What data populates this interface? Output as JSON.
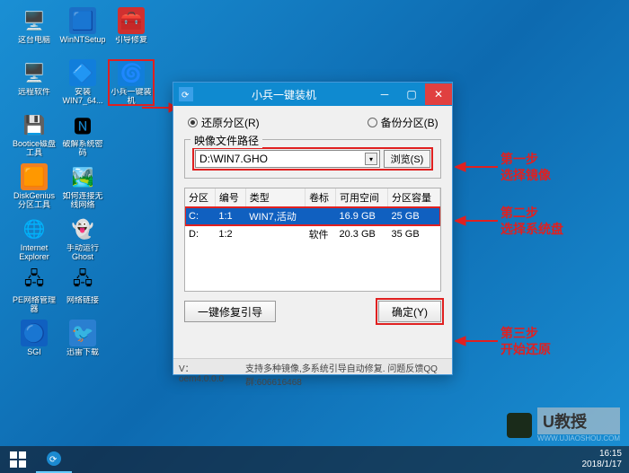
{
  "desktop": {
    "rows": [
      [
        {
          "label": "这台电脑",
          "emoji": "🖥️",
          "bg": ""
        },
        {
          "label": "WinNTSetup",
          "emoji": "🟦",
          "bg": "#1b6fc6"
        },
        {
          "label": "引导修复",
          "emoji": "🧰",
          "bg": "#d03030"
        }
      ],
      [
        {
          "label": "远程软件",
          "emoji": "🖥️",
          "bg": ""
        },
        {
          "label": "安装WIN7_64...",
          "emoji": "🔷",
          "bg": "#117edb"
        },
        {
          "label": "小兵一键装机",
          "emoji": "🌀",
          "bg": "#117edb",
          "highlight": true
        }
      ],
      [
        {
          "label": "Bootice磁盘工具",
          "emoji": "💾",
          "bg": ""
        },
        {
          "label": "破解系统密码",
          "emoji": "🅽",
          "bg": ""
        }
      ],
      [
        {
          "label": "DiskGenius分区工具",
          "emoji": "🟧",
          "bg": "#f08020"
        },
        {
          "label": "如何连接无线网络",
          "emoji": "🏞️",
          "bg": ""
        }
      ],
      [
        {
          "label": "Internet Explorer",
          "emoji": "🌐",
          "bg": ""
        },
        {
          "label": "手动运行Ghost",
          "emoji": "👻",
          "bg": ""
        }
      ],
      [
        {
          "label": "PE网络管理器",
          "emoji": "🖧",
          "bg": ""
        },
        {
          "label": "网络链接",
          "emoji": "🖧",
          "bg": ""
        }
      ],
      [
        {
          "label": "SGI",
          "emoji": "🔵",
          "bg": "#1060c0"
        },
        {
          "label": "迅雷下载",
          "emoji": "🐦",
          "bg": "#2a7fd0"
        }
      ]
    ]
  },
  "window": {
    "title": "小兵一键装机",
    "radio_restore": "还原分区(R)",
    "radio_backup": "备份分区(B)",
    "fieldset_label": "映像文件路径",
    "path_value": "D:\\WIN7.GHO",
    "browse_label": "浏览(S)",
    "table": {
      "headers": [
        "分区",
        "编号",
        "类型",
        "卷标",
        "可用空间",
        "分区容量"
      ],
      "rows": [
        {
          "cells": [
            "C:",
            "1:1",
            "WIN7,活动",
            "",
            "16.9 GB",
            "25 GB"
          ],
          "selected": true
        },
        {
          "cells": [
            "D:",
            "1:2",
            "",
            "软件",
            "20.3 GB",
            "35 GB"
          ],
          "selected": false
        }
      ]
    },
    "repair_label": "一键修复引导",
    "ok_label": "确定(Y)",
    "status_version": "V：oem4.0.0.0",
    "status_info": "支持多种镜像,多系统引导自动修复. 问题反馈QQ群:606616468"
  },
  "annotations": {
    "step1_title": "第一步",
    "step1_text": "选择镜像",
    "step2_title": "第二步",
    "step2_text": "选择系统盘",
    "step3_title": "第三步",
    "step3_text": "开始还原"
  },
  "taskbar": {
    "time": "16:15",
    "date": "2018/1/17"
  },
  "watermark": {
    "brand": "U教授",
    "url": "WWW.UJIAOSHOU.COM"
  }
}
